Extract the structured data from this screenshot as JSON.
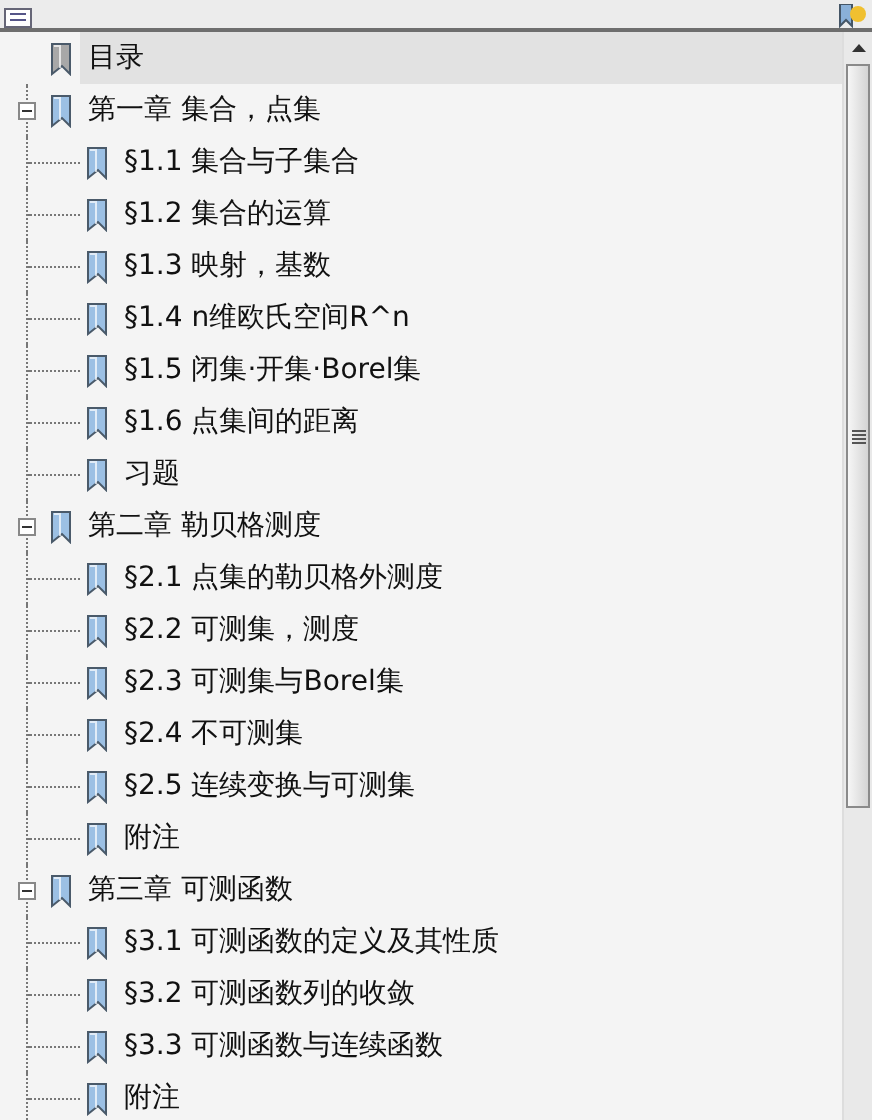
{
  "bookmarks": [
    {
      "label": "目录",
      "selected": true
    },
    {
      "label": "第一章  集合，点集",
      "selected": false,
      "expanded": true,
      "children": [
        {
          "label": "§1.1  集合与子集合",
          "selected": false
        },
        {
          "label": "§1.2  集合的运算",
          "selected": false
        },
        {
          "label": "§1.3  映射，基数",
          "selected": false
        },
        {
          "label": "§1.4  n维欧氏空间R^n",
          "selected": false
        },
        {
          "label": "§1.5  闭集·开集·Borel集",
          "selected": false
        },
        {
          "label": "§1.6  点集间的距离",
          "selected": false
        },
        {
          "label": "习题",
          "selected": false
        }
      ]
    },
    {
      "label": "第二章  勒贝格测度",
      "selected": false,
      "expanded": true,
      "children": [
        {
          "label": "§2.1  点集的勒贝格外测度",
          "selected": false
        },
        {
          "label": "§2.2  可测集，测度",
          "selected": false
        },
        {
          "label": "§2.3  可测集与Borel集",
          "selected": false
        },
        {
          "label": "§2.4  不可测集",
          "selected": false
        },
        {
          "label": "§2.5  连续变换与可测集",
          "selected": false
        },
        {
          "label": "附注",
          "selected": false
        }
      ]
    },
    {
      "label": "第三章  可测函数",
      "selected": false,
      "expanded": true,
      "children": [
        {
          "label": "§3.1  可测函数的定义及其性质",
          "selected": false
        },
        {
          "label": "§3.2  可测函数列的收敛",
          "selected": false
        },
        {
          "label": "§3.3  可测函数与连续函数",
          "selected": false
        },
        {
          "label": "附注",
          "selected": false
        }
      ]
    }
  ]
}
